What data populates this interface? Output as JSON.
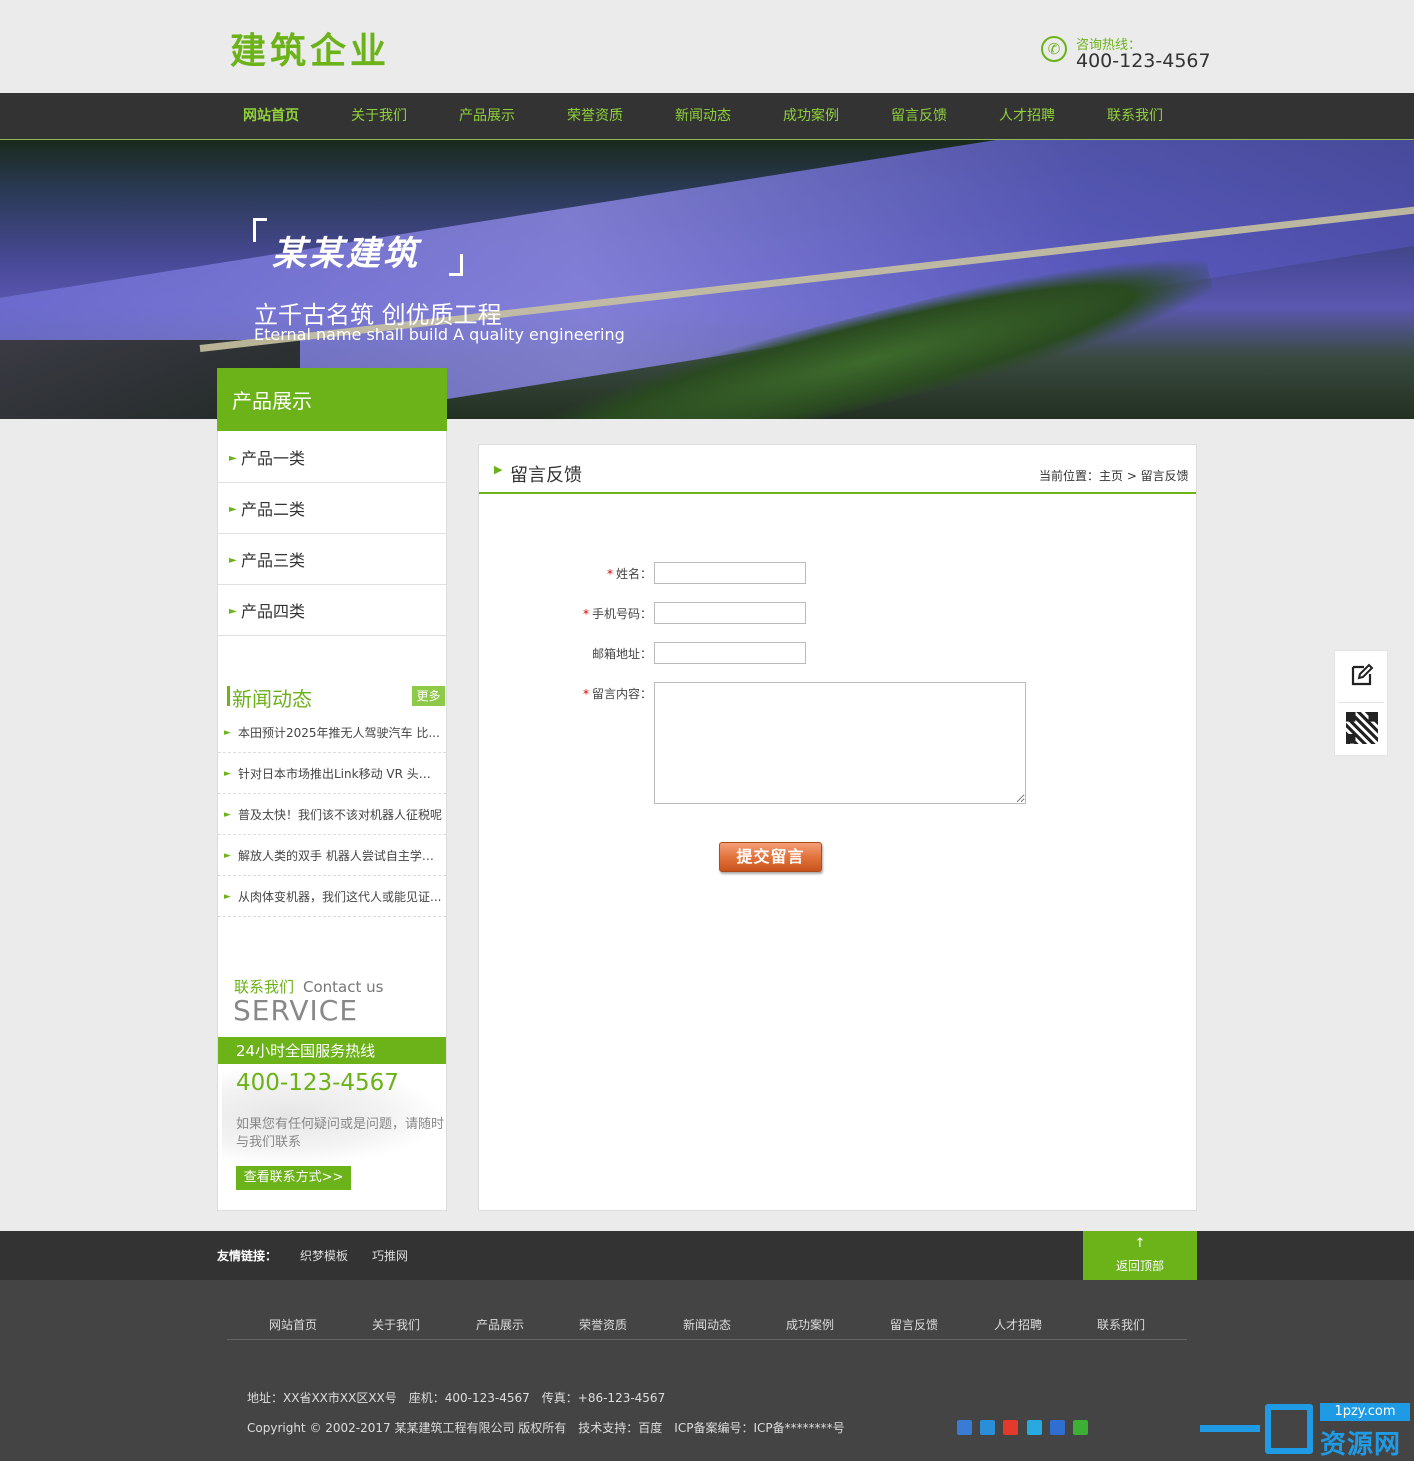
{
  "header": {
    "logo": "建筑企业",
    "hotline_label": "咨询热线：",
    "hotline_number": "400-123-4567",
    "phone_icon": "✆"
  },
  "nav": {
    "items": [
      "网站首页",
      "关于我们",
      "产品展示",
      "荣誉资质",
      "新闻动态",
      "成功案例",
      "留言反馈",
      "人才招聘",
      "联系我们"
    ]
  },
  "banner": {
    "brand": "某某建筑",
    "slogan": "立千古名筑 创优质工程",
    "slogan_en": "Eternal name shall build A quality engineering"
  },
  "sidebar": {
    "title": "产品展示",
    "categories": [
      "产品一类",
      "产品二类",
      "产品三类",
      "产品四类"
    ],
    "news_title": "新闻动态",
    "news_more": "更多",
    "news": [
      "本田预计2025年推无人驾驶汽车 比...",
      "针对日本市场推出Link移动 VR 头盔:...",
      "普及太快！我们该不该对机器人征税呢",
      "解放人类的双手 机器人尝试自主学习...",
      "从肉体变机器，我们这代人或能见证..."
    ],
    "contact_cn": "联系我们",
    "contact_en": "Contact us",
    "service": "SERVICE",
    "hotline_band": "24小时全国服务热线",
    "phone": "400-123-4567",
    "desc": "如果您有任何疑问或是问题，请随时与我们联系",
    "button": "查看联系方式>>"
  },
  "main": {
    "title": "留言反馈",
    "breadcrumb": "当前位置：主页 > 留言反馈",
    "form": {
      "name_label": "姓名：",
      "phone_label": "手机号码：",
      "email_label": "邮箱地址：",
      "message_label": "留言内容：",
      "required_mark": "*",
      "submit": "提交留言"
    }
  },
  "float_panel": {
    "edit_icon": "edit-icon",
    "qr_icon": "qr-code-icon"
  },
  "links": {
    "label": "友情链接：",
    "items": [
      "织梦模板",
      "巧推网"
    ],
    "back_top_arrow": "↑",
    "back_top": "返回顶部"
  },
  "footer": {
    "nav": [
      "网站首页",
      "关于我们",
      "产品展示",
      "荣誉资质",
      "新闻动态",
      "成功案例",
      "留言反馈",
      "人才招聘",
      "联系我们"
    ],
    "address": "地址：XX省XX市XX区XX号　座机：400-123-4567　传真：+86-123-4567",
    "copyright": "Copyright © 2002-2017 某某建筑工程有限公司 版权所有　技术支持：百度　ICP备案编号：ICP备********号"
  },
  "watermark": {
    "url": "1pzy.com",
    "text": "资源网"
  },
  "colors": {
    "accent": "#6cb219",
    "nav_bg": "#333333",
    "footer_bg": "#444444",
    "submit": "#e2733c",
    "watermark": "#1f9be6"
  }
}
